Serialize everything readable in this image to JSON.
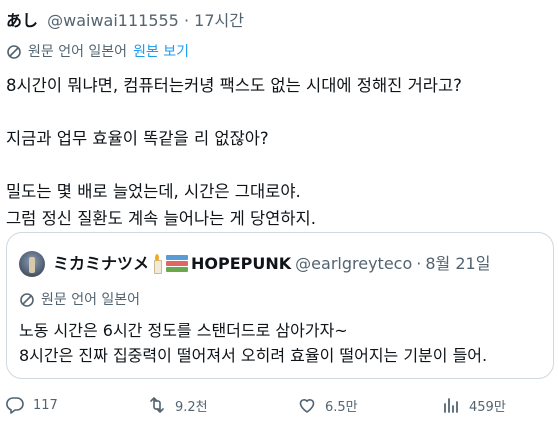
{
  "tweet": {
    "display_name": "あし",
    "handle": "@waiwai111555",
    "dot": "·",
    "time": "17시간",
    "translation": {
      "label": "원문 언어 일본어",
      "show_original": "원본 보기"
    },
    "lines": [
      "8시간이 뭐냐면, 컴퓨터는커녕 팩스도 없는 시대에 정해진 거라고?",
      "지금과 업무 효율이 똑같을 리 없잖아?",
      "밀도는 몇 배로 늘었는데, 시간은 그대로야.",
      "그럼 정신 질환도 계속 늘어나는 게 당연하지."
    ]
  },
  "quote": {
    "display_name": "ミカミナツメ",
    "display_name_suffix": "HOPEPUNK",
    "handle": "@earlgreyteco",
    "dot": "·",
    "date": "8월 21일",
    "translation_label": "원문 언어 일본어",
    "lines": [
      "노동 시간은 6시간 정도를 스탠더드로 삼아가자~",
      "8시간은 진짜 집중력이 떨어져서 오히려 효율이 떨어지는 기분이 들어."
    ]
  },
  "actions": {
    "replies": "117",
    "retweets": "9.2천",
    "likes": "6.5만",
    "views": "459만"
  },
  "icons": {
    "translate": "translate-icon",
    "reply": "reply-icon",
    "retweet": "retweet-icon",
    "like": "heart-icon",
    "views": "views-icon",
    "quote_candle": "candle-emoji-icon",
    "quote_books": "books-emoji-icon"
  },
  "colors": {
    "text_primary": "#0f1419",
    "text_secondary": "#536471",
    "link": "#1d9bf0",
    "border": "#cfd9de"
  }
}
